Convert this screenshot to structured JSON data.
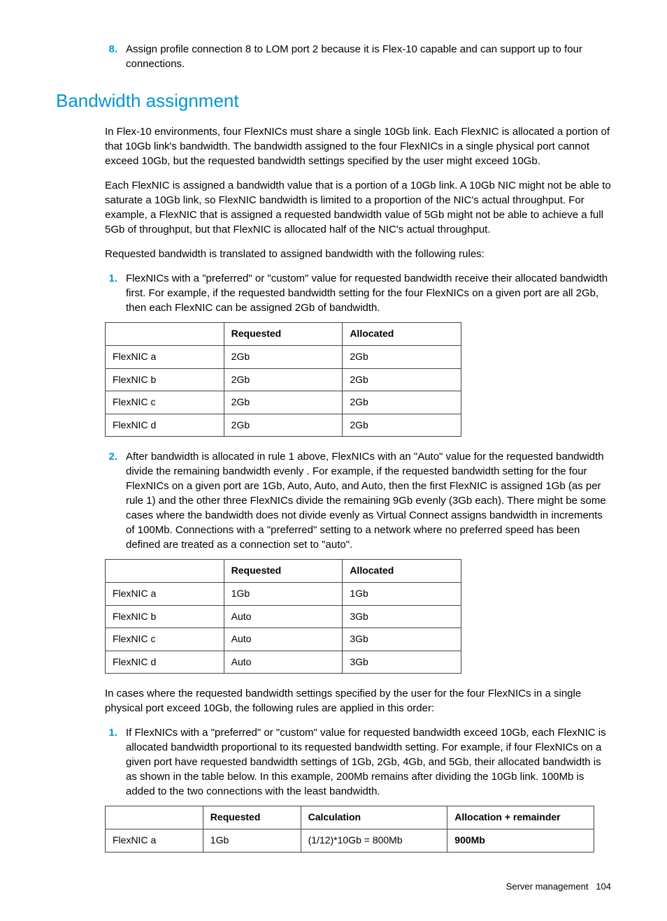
{
  "intro_item": {
    "num": "8.",
    "text": "Assign profile connection 8 to LOM port 2 because it is Flex-10 capable and can support up to four connections."
  },
  "section_title": "Bandwidth assignment",
  "para1": "In Flex-10 environments, four FlexNICs must share a single 10Gb link. Each FlexNIC is allocated a portion of that 10Gb link's bandwidth. The bandwidth assigned to the four FlexNICs in a single physical port cannot exceed 10Gb, but the requested bandwidth settings specified by the user might exceed 10Gb.",
  "para2": "Each FlexNIC is assigned a bandwidth value that is a portion of a 10Gb link. A 10Gb NIC might not be able to saturate a 10Gb link, so FlexNIC bandwidth is limited to a proportion of the NIC's actual throughput. For example, a FlexNIC that is assigned a requested bandwidth value of 5Gb might not be able to achieve a full 5Gb of throughput, but that FlexNIC is allocated half of the NIC's actual throughput.",
  "para3": "Requested bandwidth is translated to assigned bandwidth with the following rules:",
  "rule1": {
    "num": "1.",
    "text": "FlexNICs with a \"preferred\" or \"custom\" value for requested bandwidth receive their allocated bandwidth first. For example, if the requested bandwidth setting for the four FlexNICs on a given port are all 2Gb, then each FlexNIC can be assigned 2Gb of bandwidth."
  },
  "table1": {
    "headers": [
      "",
      "Requested",
      "Allocated"
    ],
    "rows": [
      [
        "FlexNIC a",
        "2Gb",
        "2Gb"
      ],
      [
        "FlexNIC b",
        "2Gb",
        "2Gb"
      ],
      [
        "FlexNIC c",
        "2Gb",
        "2Gb"
      ],
      [
        "FlexNIC d",
        "2Gb",
        "2Gb"
      ]
    ]
  },
  "rule2": {
    "num": "2.",
    "text": "After bandwidth is allocated in rule 1 above, FlexNICs with an \"Auto\" value for the requested bandwidth divide the remaining bandwidth evenly . For example, if the requested bandwidth setting for the four FlexNICs on a given port are 1Gb, Auto, Auto, and Auto, then the first FlexNIC is assigned 1Gb (as per rule 1) and the other three FlexNICs divide the remaining 9Gb evenly (3Gb each). There might be some cases where the bandwidth does not divide evenly as Virtual Connect assigns bandwidth in increments of 100Mb. Connections with a \"preferred\" setting to a network where no preferred speed has been defined are treated as a connection set to \"auto\"."
  },
  "table2": {
    "headers": [
      "",
      "Requested",
      "Allocated"
    ],
    "rows": [
      [
        "FlexNIC a",
        "1Gb",
        "1Gb"
      ],
      [
        "FlexNIC b",
        "Auto",
        "3Gb"
      ],
      [
        "FlexNIC c",
        "Auto",
        "3Gb"
      ],
      [
        "FlexNIC d",
        "Auto",
        "3Gb"
      ]
    ]
  },
  "para4": "In cases where the requested bandwidth settings specified by the user for the four FlexNICs in a single physical port exceed 10Gb, the following rules are applied in this order:",
  "rule3": {
    "num": "1.",
    "text": "If FlexNICs with a \"preferred\" or \"custom\" value for requested bandwidth exceed 10Gb, each FlexNIC is allocated bandwidth proportional to its requested bandwidth setting. For example, if four FlexNICs on a given port have requested bandwidth settings of 1Gb, 2Gb, 4Gb, and 5Gb, their allocated bandwidth is as shown in the table below. In this example, 200Mb remains after dividing the 10Gb link. 100Mb is added to the two connections with the least bandwidth."
  },
  "table3": {
    "headers": [
      "",
      "Requested",
      "Calculation",
      "Allocation + remainder"
    ],
    "rows": [
      [
        "FlexNIC a",
        "1Gb",
        "(1/12)*10Gb = 800Mb",
        "900Mb"
      ]
    ]
  },
  "footer": {
    "section": "Server management",
    "page": "104"
  }
}
